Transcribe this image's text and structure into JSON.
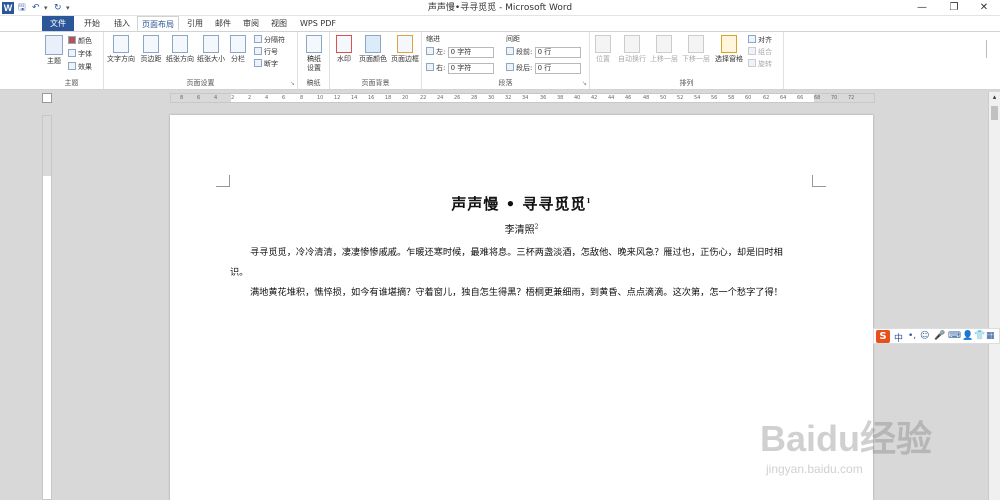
{
  "window": {
    "title": "声声慢•寻寻觅觅 - Microsoft Word",
    "minimize": "—",
    "restore": "❐",
    "close": "✕"
  },
  "qat": {
    "save": "🖫",
    "undo": "↶",
    "redo": "↻"
  },
  "tabs": [
    "文件",
    "开始",
    "插入",
    "页面布局",
    "引用",
    "邮件",
    "审阅",
    "视图",
    "WPS PDF"
  ],
  "active_tab": "页面布局",
  "ribbon": {
    "theme": {
      "label": "主题",
      "btn": "主题",
      "colors": "颜色",
      "fonts": "字体",
      "effects": "效果"
    },
    "page_setup": {
      "label": "页面设置",
      "text_dir": "文字方向",
      "margins": "页边距",
      "orientation": "纸张方向",
      "size": "纸张大小",
      "columns": "分栏",
      "breaks": "分隔符",
      "line_numbers": "行号",
      "hyphenation": "断字"
    },
    "draft": {
      "label": "稿纸",
      "btn": "稿纸设置"
    },
    "page_background": {
      "label": "页面背景",
      "watermark": "水印",
      "page_color": "页面颜色",
      "page_borders": "页面边框"
    },
    "paragraph": {
      "label": "段落",
      "indent_label": "缩进",
      "spacing_label": "间距",
      "left_label": "左:",
      "left_value": "0 字符",
      "right_label": "右:",
      "right_value": "0 字符",
      "before_label": "段前:",
      "before_value": "0 行",
      "after_label": "段后:",
      "after_value": "0 行"
    },
    "arrange": {
      "label": "排列",
      "position": "位置",
      "wrap": "自动换行",
      "bring_forward": "上移一层",
      "send_backward": "下移一层",
      "selection_pane": "选择窗格",
      "align": "对齐",
      "group": "组合",
      "rotate": "旋转"
    }
  },
  "document": {
    "title": "声声慢 • 寻寻觅觅",
    "title_note": "1",
    "author": "李清照",
    "author_note": "2",
    "paragraphs": [
      "寻寻觅觅，冷冷清清，凄凄惨惨戚戚。乍暖还寒时候，最难将息。三杯两盏淡酒，怎敌他、晚来风急？雁过也，正伤心，却是旧时相识。",
      "满地黄花堆积，憔悴损，如今有谁堪摘？守着窗儿，独自怎生得黑？梧桐更兼细雨，到黄昏、点点滴滴。这次第，怎一个愁字了得！"
    ]
  },
  "ruler_marks": [
    "8",
    "6",
    "4",
    "2",
    "2",
    "4",
    "6",
    "8",
    "10",
    "12",
    "14",
    "16",
    "18",
    "20",
    "22",
    "24",
    "26",
    "28",
    "30",
    "32",
    "34",
    "36",
    "38",
    "40",
    "42",
    "44",
    "46",
    "48",
    "50",
    "52",
    "54",
    "56",
    "58",
    "60",
    "62",
    "64",
    "66",
    "68",
    "70",
    "72"
  ],
  "ime": {
    "logo": "S",
    "mode": "中",
    "punct": "•,",
    "emoji": "☺",
    "voice": "🎤",
    "keyboard": "⌨",
    "user": "👤",
    "skin": "👕",
    "tools": "▦"
  },
  "watermark": {
    "brand": "Baidu经验",
    "url": "jingyan.baidu.com"
  }
}
